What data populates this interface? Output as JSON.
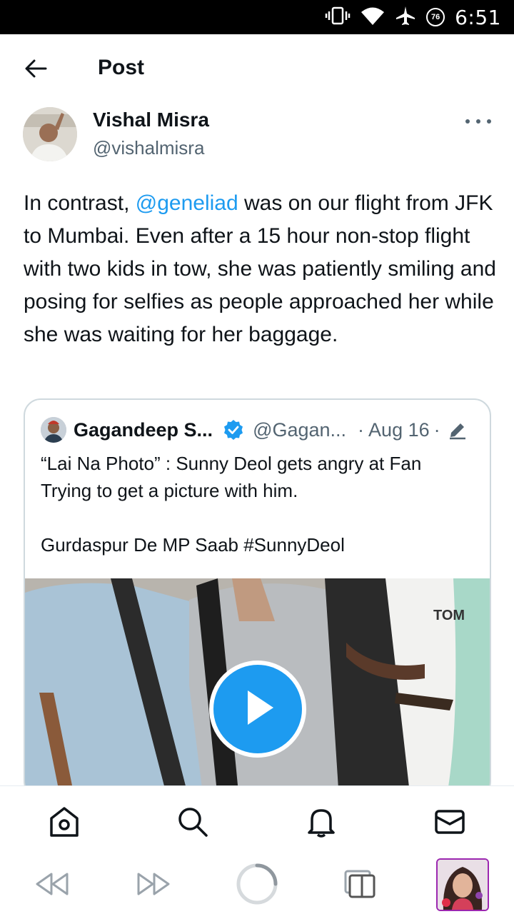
{
  "status_bar": {
    "time": "6:51",
    "battery_level": "76",
    "icons": [
      "vibrate-icon",
      "wifi-icon",
      "airplane-mode-icon",
      "battery-saver-icon"
    ]
  },
  "header": {
    "title": "Post",
    "back_icon": "arrow-left-icon"
  },
  "post": {
    "author_name": "Vishal Misra",
    "author_handle": "@vishalmisra",
    "text_before_mention": "In contrast, ",
    "mention": "@geneliad",
    "text_after_mention": " was on our flight from JFK to Mumbai. Even after a 15 hour non-stop flight with two kids in tow, she was patiently smiling and posing for selfies as people approached her while she was waiting for her baggage."
  },
  "quote": {
    "author_name": "Gagandeep S...",
    "author_handle": "@Gagan...",
    "dot": "·",
    "date": "Aug 16",
    "dot2": "·",
    "text_line1": "“Lai Na Photo” : Sunny Deol gets angry at Fan Trying to get a picture with him.",
    "text_line2": "Gurdaspur De MP Saab #SunnyDeol"
  },
  "bottom_nav": {
    "items": [
      "home-icon",
      "search-icon",
      "notifications-icon",
      "messages-icon"
    ]
  },
  "system_nav": {
    "items": [
      "rewind-icon",
      "fast-forward-icon",
      "loading-spinner-icon",
      "tabs-icon",
      "profile-thumbnail"
    ]
  },
  "colors": {
    "accent": "#1d9bf0",
    "text_primary": "#0f1419",
    "text_secondary": "#536471",
    "border": "#cfd9de"
  }
}
